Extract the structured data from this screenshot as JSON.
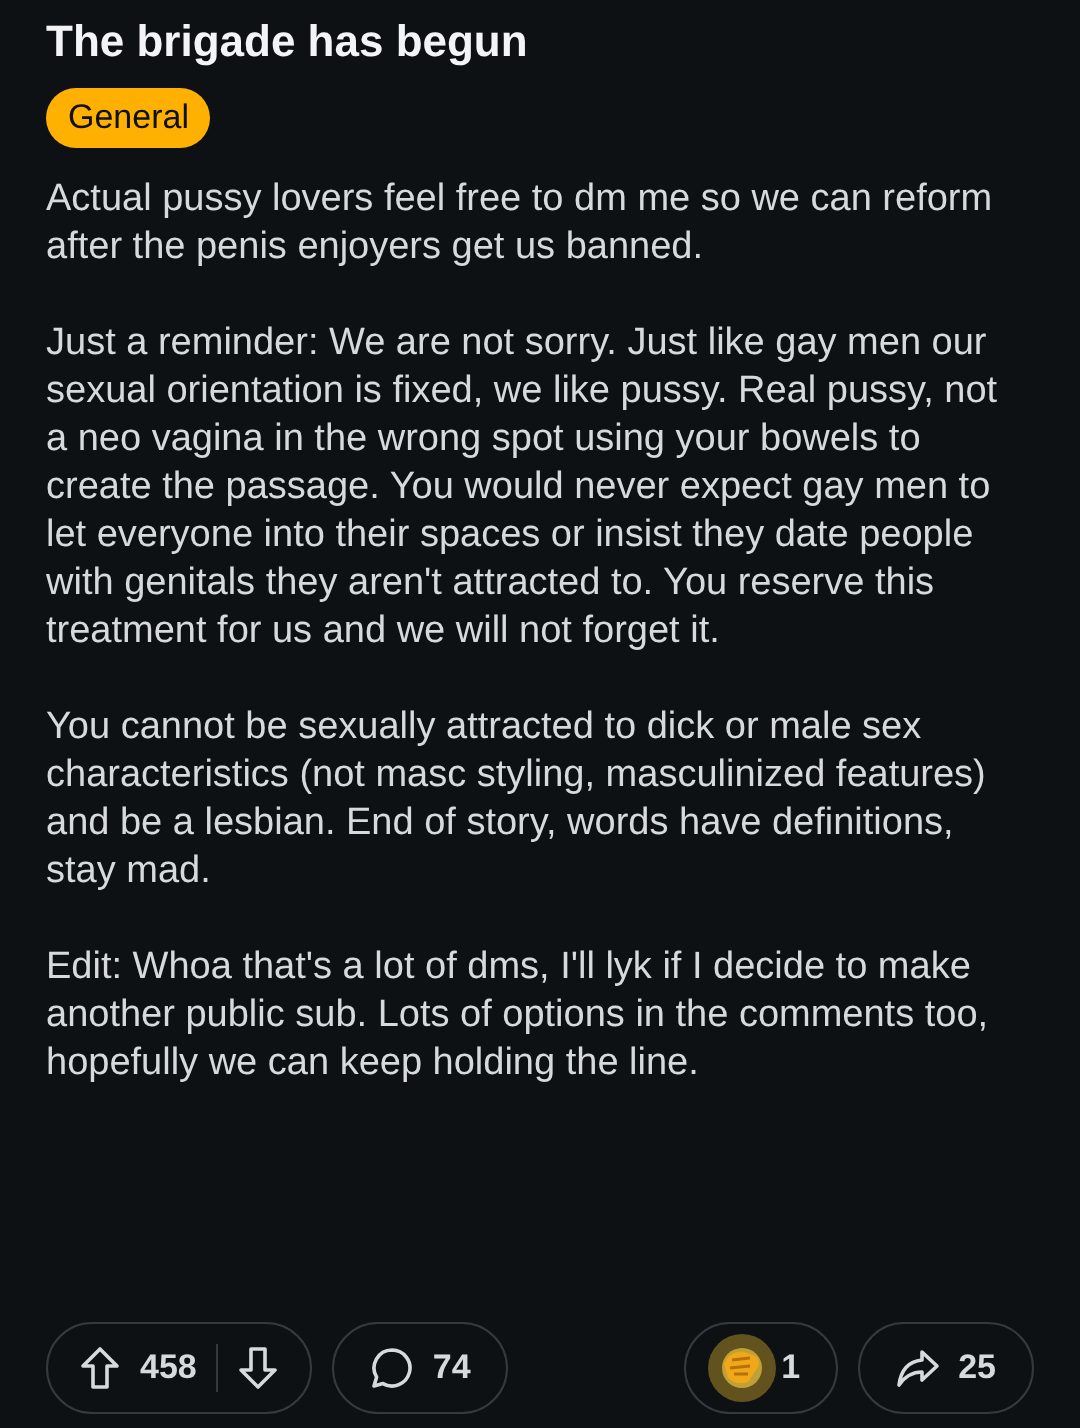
{
  "post": {
    "title": "The brigade has begun",
    "flair": "General",
    "paragraphs": [
      "Actual pussy lovers feel free to dm me so we can reform after the penis enjoyers get us banned.",
      "Just a reminder: We are not sorry. Just like gay men our sexual orientation is fixed, we like pussy. Real pussy, not a neo vagina in the wrong spot using your bowels to create the passage. You would never expect gay men to let everyone into their spaces or insist they date people with genitals they aren't attracted to. You reserve this treatment for us and we will not forget it.",
      "You cannot be sexually attracted to dick or male sex characteristics (not masc styling, masculinized features) and be a lesbian. End of story, words have definitions, stay mad.",
      "Edit: Whoa that's a lot of dms, I'll lyk if I decide to make another public sub. Lots of options in the comments too, hopefully we can keep holding the line."
    ]
  },
  "actions": {
    "votes": "458",
    "comments": "74",
    "awards": "1",
    "shares": "25"
  }
}
